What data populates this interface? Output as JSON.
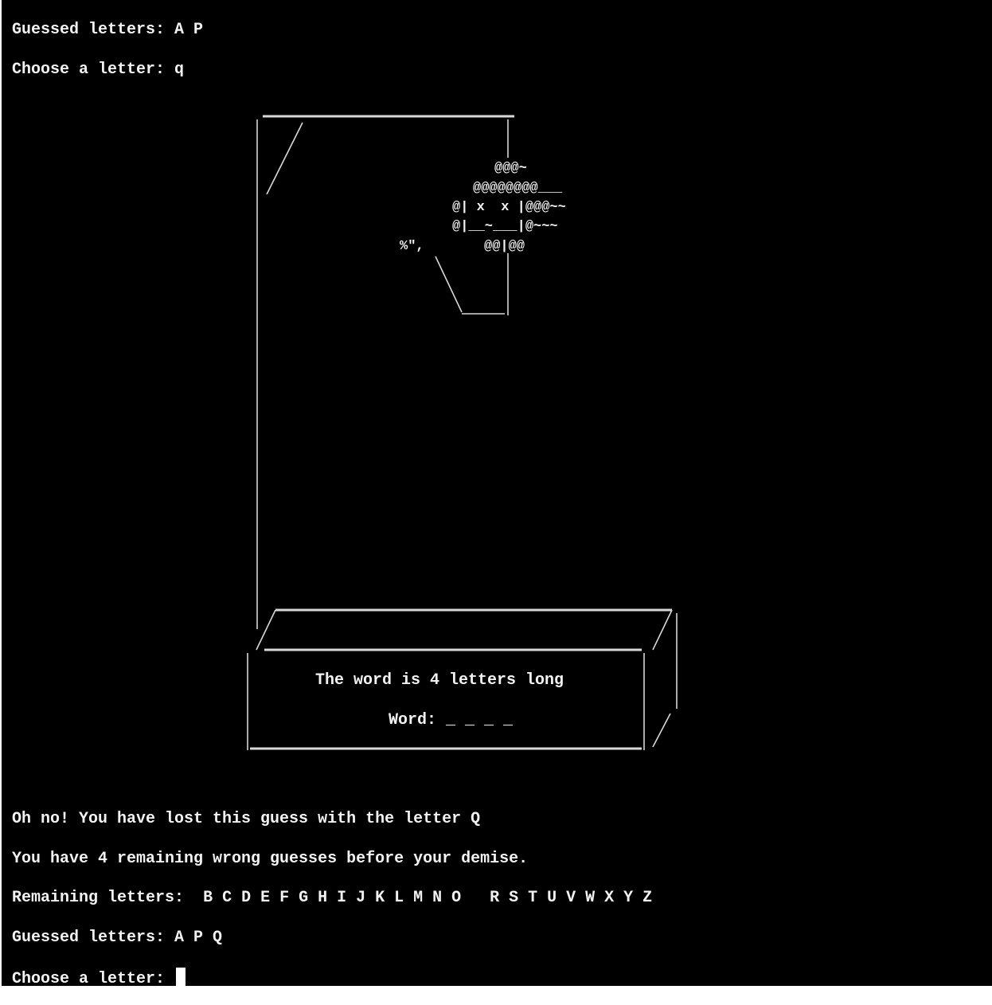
{
  "terminal": {
    "top": {
      "guessed_prev": "Guessed letters: A P",
      "prompt_prev_label": "Choose a letter: ",
      "prompt_prev_value": "q"
    },
    "gallows": {
      "hair_line1": "@@@~",
      "hair_line2": "@@@@@@@@___",
      "face_line1": "@| x  x |@@@~~",
      "face_line2": "@|__~___|@~~~",
      "chin": "@@|@@",
      "tuft": "%\",",
      "box_info": "The word is 4 letters long",
      "word_label": "Word:",
      "word_blanks": "_ _ _ _"
    },
    "bottom": {
      "result": "Oh no! You have lost this guess with the letter Q",
      "remaining_wrong": "You have 4 remaining wrong guesses before your demise.",
      "remaining_letters_label": "Remaining letters:",
      "remaining_letters": "B C D E F G H I J K L M N O   R S T U V W X Y Z",
      "guessed_now": "Guessed letters: A P Q",
      "prompt_label": "Choose a letter: "
    }
  }
}
